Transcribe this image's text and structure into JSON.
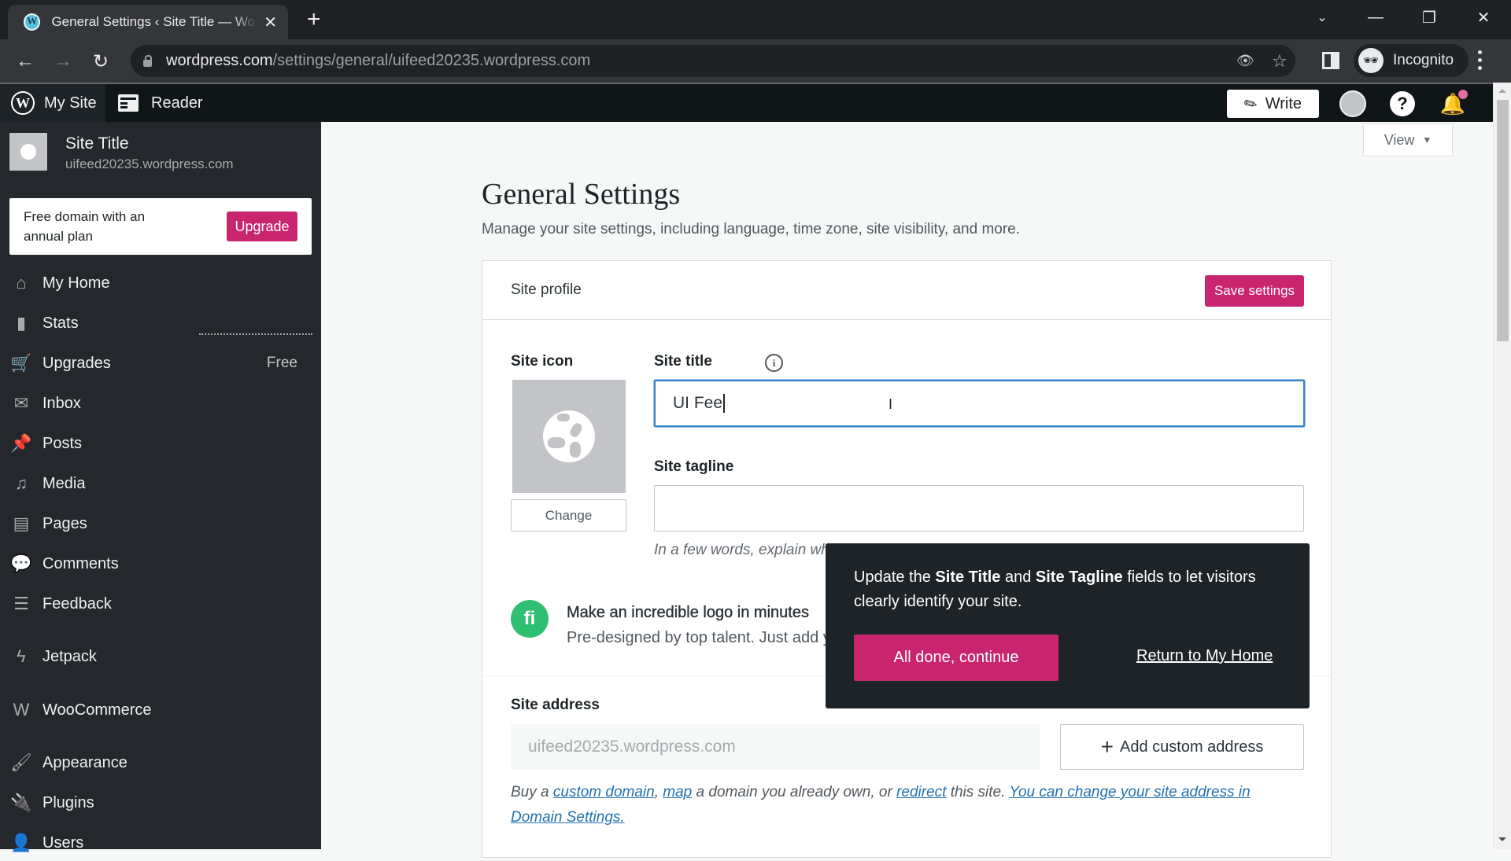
{
  "browser": {
    "tab_title": "General Settings ‹ Site Title — WordPress.com",
    "tab_favicon": "W",
    "url_host": "wordpress.com",
    "url_path": "/settings/general/uifeed20235.wordpress.com",
    "profile_label": "Incognito",
    "icons": {
      "new_tab": "+",
      "back": "←",
      "forward": "→",
      "reload": "↻",
      "tab_close": "✕",
      "tab_search": "⌄",
      "minimize": "—",
      "restore": "❐",
      "close": "✕",
      "eye_off": "👁",
      "star": "☆",
      "incognito": "🕶"
    }
  },
  "adminbar": {
    "my_site": "My Site",
    "reader": "Reader",
    "write": "Write",
    "help": "?",
    "bell": "🔔",
    "wp_logo": "W",
    "leaf": "✎"
  },
  "sidebar": {
    "site_name": "Site Title",
    "site_url": "uifeed20235.wordpress.com",
    "upsell_text": "Free domain with an annual plan",
    "upsell_button": "Upgrade",
    "items": [
      {
        "label": "My Home",
        "icon": "⌂",
        "badge": ""
      },
      {
        "label": "Stats",
        "icon": "▮",
        "badge": ""
      },
      {
        "label": "Upgrades",
        "icon": "🛒",
        "badge": "Free"
      },
      {
        "label": "Inbox",
        "icon": "✉",
        "badge": ""
      },
      {
        "label": "Posts",
        "icon": "📌",
        "badge": ""
      },
      {
        "label": "Media",
        "icon": "♫",
        "badge": ""
      },
      {
        "label": "Pages",
        "icon": "▤",
        "badge": ""
      },
      {
        "label": "Comments",
        "icon": "💬",
        "badge": ""
      },
      {
        "label": "Feedback",
        "icon": "☰",
        "badge": ""
      },
      {
        "label": "Jetpack",
        "icon": "ϟ",
        "badge": ""
      },
      {
        "label": "WooCommerce",
        "icon": "W",
        "badge": ""
      },
      {
        "label": "Appearance",
        "icon": "🖌",
        "badge": ""
      },
      {
        "label": "Plugins",
        "icon": "🔌",
        "badge": ""
      },
      {
        "label": "Users",
        "icon": "👤",
        "badge": ""
      }
    ]
  },
  "main": {
    "view_button": "View",
    "view_caret": "▼",
    "title": "General Settings",
    "subtitle": "Manage your site settings, including language, time zone, site visibility, and more.",
    "card": {
      "header": "Site profile",
      "save_button": "Save settings",
      "site_icon_label": "Site icon",
      "info_icon": "i",
      "change_button": "Change",
      "site_title_label": "Site title",
      "site_title_value": "UI Fee",
      "site_tagline_label": "Site tagline",
      "site_tagline_value": "",
      "tagline_hint": "In a few words, explain what this site is about.",
      "promo_logo": "fi",
      "promo_title": "Make an incredible logo in minutes",
      "promo_subtitle": "Pre-designed by top talent. Just add your touch.",
      "site_address_label": "Site address",
      "site_address_value": "uifeed20235.wordpress.com",
      "add_custom_address": "Add custom address",
      "address_help": {
        "p1": "Buy a ",
        "link_custom_domain": "custom domain",
        "p2": ", ",
        "link_map": "map",
        "p3": " a domain you already own, or ",
        "link_redirect": "redirect",
        "p4": " this site. ",
        "link_domain_settings": "You can change your site address in Domain Settings."
      }
    }
  },
  "tour": {
    "text_1": "Update the ",
    "bold_1": "Site Title",
    "text_2": " and ",
    "bold_2": "Site Tagline",
    "text_3": " fields to let visitors clearly identify your site.",
    "primary_button": "All done, continue",
    "secondary_link": "Return to My Home"
  },
  "colors": {
    "accent": "#c9256e",
    "focus": "#3582c4",
    "sidebar_bg": "#24272c",
    "admin_bar_bg": "#101517",
    "link": "#2271b1"
  }
}
